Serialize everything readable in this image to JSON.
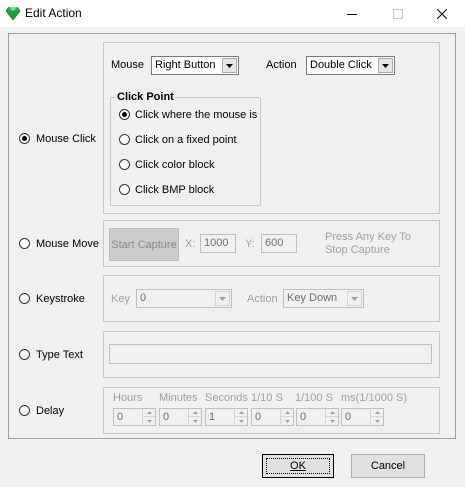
{
  "window": {
    "title": "Edit Action",
    "minimize_icon": "minimize-icon",
    "maximize_icon": "maximize-icon",
    "close_icon": "close-icon",
    "app_icon": "green-gem-icon"
  },
  "mouse_click": {
    "label": "Mouse Click",
    "selected": true,
    "mouse_label": "Mouse",
    "mouse_value": "Right Button",
    "action_label": "Action",
    "action_value": "Double Click",
    "click_point": {
      "title": "Click Point",
      "options": [
        {
          "label": "Click where the mouse is",
          "checked": true
        },
        {
          "label": "Click on a fixed point",
          "checked": false
        },
        {
          "label": "Click color block",
          "checked": false
        },
        {
          "label": "Click BMP block",
          "checked": false
        }
      ]
    }
  },
  "mouse_move": {
    "label": "Mouse Move",
    "start_capture": "Start Capture",
    "x_label": "X:",
    "x_value": "1000",
    "y_label": "Y:",
    "y_value": "600",
    "hint_line1": "Press Any Key To",
    "hint_line2": "Stop Capture"
  },
  "keystroke": {
    "label": "Keystroke",
    "key_label": "Key",
    "key_value": "0",
    "action_label": "Action",
    "action_value": "Key Down"
  },
  "type_text": {
    "label": "Type Text",
    "value": ""
  },
  "delay": {
    "label": "Delay",
    "headers": [
      "Hours",
      "Minutes",
      "Seconds",
      "1/10 S",
      "1/100 S",
      "ms(1/1000 S)"
    ],
    "values": [
      "0",
      "0",
      "1",
      "0",
      "0",
      "0"
    ]
  },
  "buttons": {
    "ok": "OK",
    "cancel": "Cancel"
  }
}
